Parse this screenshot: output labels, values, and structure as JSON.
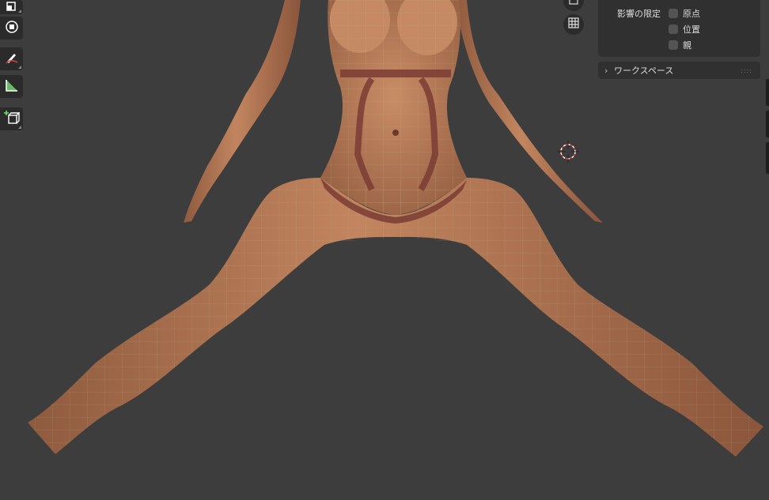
{
  "viewport": {
    "background_color": "#3d3d3d",
    "model_name": "female-base-mesh"
  },
  "toolbar": {
    "tools": [
      {
        "name": "scale-tool",
        "icon": "scale-icon"
      },
      {
        "name": "transform-tool",
        "icon": "transform-icon"
      },
      {
        "name": "annotate-tool",
        "icon": "annotate-pencil-icon"
      },
      {
        "name": "measure-tool",
        "icon": "ruler-icon"
      },
      {
        "name": "add-cube-tool",
        "icon": "add-cube-icon"
      }
    ]
  },
  "nav_gizmo": {
    "buttons": [
      "camera-view-icon",
      "grid-view-icon"
    ]
  },
  "options_panel": {
    "affect_only_label": "影響の限定",
    "options": [
      {
        "label": "原点",
        "checked": false
      },
      {
        "label": "位置",
        "checked": false
      },
      {
        "label": "親",
        "checked": false
      }
    ]
  },
  "workspace_panel": {
    "label": "ワークスペース",
    "expanded": false
  },
  "colors": {
    "panel_bg": "#303030",
    "skin": "#b87a58",
    "seam": "#7a3c34",
    "wire": "#b8c98a",
    "cursor": "#e03c3c"
  }
}
